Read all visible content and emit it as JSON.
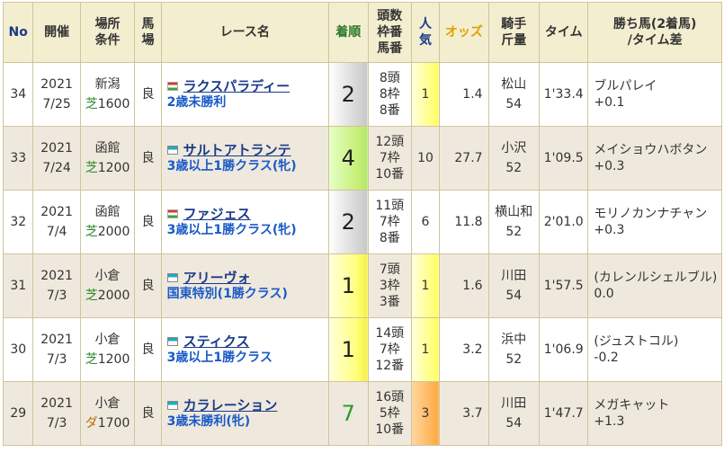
{
  "headers": {
    "no": "No",
    "date_l1": "開催",
    "course_l1": "場所",
    "course_l2": "条件",
    "baba_l1": "馬",
    "baba_l2": "場",
    "race": "レース名",
    "chaku": "着順",
    "horse_l1": "頭数",
    "horse_l2": "枠番",
    "horse_l3": "馬番",
    "ninki_l1": "人",
    "ninki_l2": "気",
    "odds": "オッズ",
    "jockey_l1": "騎手",
    "jockey_l2": "斤量",
    "time": "タイム",
    "winner_l1": "勝ち馬(2着馬)",
    "winner_l2": "/タイム差"
  },
  "rows": [
    {
      "no": "34",
      "year": "2021",
      "date": "7/25",
      "place": "新潟",
      "surface": "芝",
      "dist": "1600",
      "baba": "良",
      "flag": "hu",
      "race_name": "ラクスパラディー",
      "race_class": "2歳未勝利",
      "chaku": "2",
      "heads": "8頭",
      "waku": "8枠",
      "umaban": "8番",
      "ninki": "1",
      "odds": "1.4",
      "jockey": "松山",
      "kin": "54",
      "time": "1'33.4",
      "winner": "ブルパレイ",
      "diff": "+0.1"
    },
    {
      "no": "33",
      "year": "2021",
      "date": "7/24",
      "place": "函館",
      "surface": "芝",
      "dist": "1200",
      "baba": "良",
      "flag": "cy",
      "race_name": "サルトアトランテ",
      "race_class": "3歳以上1勝クラス(牝)",
      "chaku": "4",
      "heads": "12頭",
      "waku": "7枠",
      "umaban": "10番",
      "ninki": "10",
      "odds": "27.7",
      "jockey": "小沢",
      "kin": "52",
      "time": "1'09.5",
      "winner": "メイショウハボタン",
      "diff": "+0.3"
    },
    {
      "no": "32",
      "year": "2021",
      "date": "7/4",
      "place": "函館",
      "surface": "芝",
      "dist": "2000",
      "baba": "良",
      "flag": "hu",
      "race_name": "ファジェス",
      "race_class": "3歳以上1勝クラス(牝)",
      "chaku": "2",
      "heads": "11頭",
      "waku": "7枠",
      "umaban": "8番",
      "ninki": "6",
      "odds": "11.8",
      "jockey": "横山和",
      "kin": "52",
      "time": "2'01.0",
      "winner": "モリノカンナチャン",
      "diff": "+0.3"
    },
    {
      "no": "31",
      "year": "2021",
      "date": "7/3",
      "place": "小倉",
      "surface": "芝",
      "dist": "2000",
      "baba": "良",
      "flag": "cy",
      "race_name": "アリーヴォ",
      "race_class": "国東特別(1勝クラス)",
      "chaku": "1",
      "heads": "7頭",
      "waku": "3枠",
      "umaban": "3番",
      "ninki": "1",
      "odds": "1.6",
      "jockey": "川田",
      "kin": "54",
      "time": "1'57.5",
      "winner": "(カレンルシェルブル)",
      "diff": "0.0"
    },
    {
      "no": "30",
      "year": "2021",
      "date": "7/3",
      "place": "小倉",
      "surface": "芝",
      "dist": "1200",
      "baba": "良",
      "flag": "cy",
      "race_name": "スティクス",
      "race_class": "3歳以上1勝クラス",
      "chaku": "1",
      "heads": "14頭",
      "waku": "7枠",
      "umaban": "12番",
      "ninki": "1",
      "odds": "3.2",
      "jockey": "浜中",
      "kin": "52",
      "time": "1'06.9",
      "winner": "(ジュストコル)",
      "diff": "-0.2"
    },
    {
      "no": "29",
      "year": "2021",
      "date": "7/3",
      "place": "小倉",
      "surface": "ダ",
      "dist": "1700",
      "baba": "良",
      "flag": "cy",
      "race_name": "カラレーション",
      "race_class": "3歳未勝利(牝)",
      "chaku": "7",
      "heads": "16頭",
      "waku": "5枠",
      "umaban": "10番",
      "ninki": "3",
      "odds": "3.7",
      "jockey": "川田",
      "kin": "54",
      "time": "1'47.7",
      "winner": "メガキャット",
      "diff": "+1.3"
    }
  ]
}
